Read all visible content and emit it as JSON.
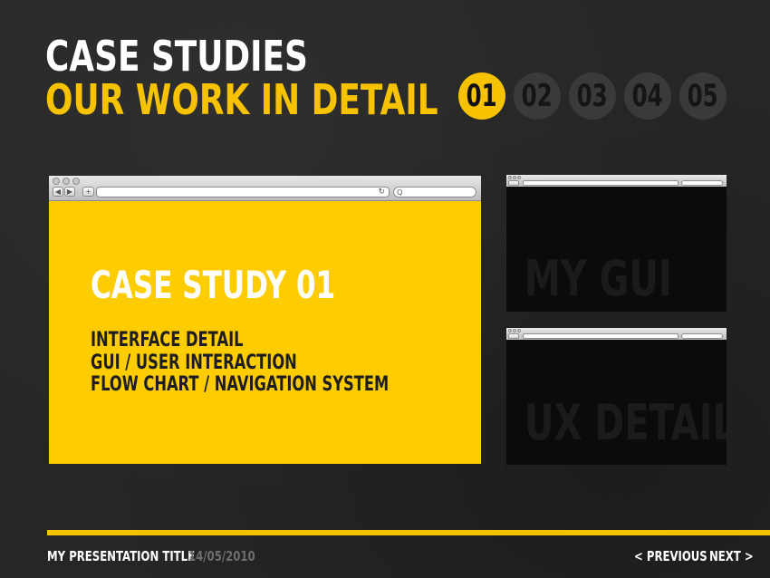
{
  "header": {
    "title_line1": "CASE STUDIES",
    "title_line2": "OUR WORK IN DETAIL"
  },
  "pager": {
    "items": [
      "01",
      "02",
      "03",
      "04",
      "05"
    ],
    "active_index": 0
  },
  "main_browser": {
    "heading": "CASE STUDY 01",
    "items": [
      "INTERFACE DETAIL",
      "GUI / USER INTERACTION",
      "FLOW CHART / NAVIGATION SYSTEM"
    ]
  },
  "thumbnails": [
    {
      "label": "MY GUI"
    },
    {
      "label": "UX DETAIL"
    }
  ],
  "browser_glyphs": {
    "back": "◀",
    "forward": "▶",
    "add": "+",
    "reload": "↻",
    "search": "Q"
  },
  "footer": {
    "presentation_title": "MY PRESENTATION TITLE",
    "date": "14/05/2010",
    "previous_label": "< PREVIOUS",
    "next_label": "NEXT >"
  },
  "colors": {
    "accent": "#f7c300",
    "background": "#262626",
    "slide_yellow": "#ffcc00"
  }
}
